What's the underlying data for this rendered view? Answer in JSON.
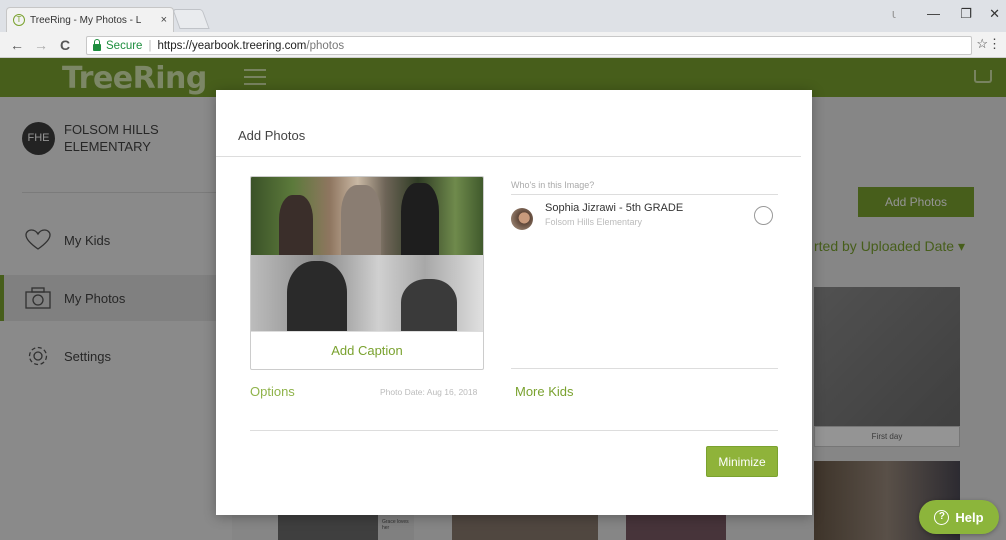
{
  "browser": {
    "tab_title": "TreeRing - My Photos - L",
    "tab_close": "×",
    "secure_label": "Secure",
    "url_host": "https://yearbook.treering.com",
    "url_path": "/photos",
    "back": "←",
    "forward": "→",
    "reload": "C",
    "star": "☆",
    "menu": "⋮",
    "minimize": "—",
    "restore": "❐",
    "close": "✕",
    "user": "⍳"
  },
  "app": {
    "logo": "TreeRing",
    "school": {
      "initials": "FHE",
      "name": "FOLSOM HILLS ELEMENTARY"
    },
    "nav": [
      {
        "label": "My Kids",
        "icon": "heart-icon"
      },
      {
        "label": "My Photos",
        "icon": "camera-icon",
        "active": true
      },
      {
        "label": "Settings",
        "icon": "gear-icon"
      }
    ],
    "main": {
      "add_photos_label": "Add Photos",
      "sort_label": "rted by Uploaded Date ▾",
      "thumb_caption": "First day",
      "small_caption": "Grace loves her"
    }
  },
  "modal": {
    "title": "Add Photos",
    "caption_link": "Add Caption",
    "options_label": "Options",
    "photo_date": "Photo Date: Aug 16, 2018",
    "who_label": "Who's in this Image?",
    "person": {
      "name": "Sophia Jizrawi - 5th GRADE",
      "school": "Folsom Hills Elementary"
    },
    "more_kids_label": "More Kids",
    "minimize_label": "Minimize"
  },
  "help": {
    "label": "Help",
    "glyph": "?"
  },
  "colors": {
    "brand_green": "#7aa22f",
    "button_green": "#8fb33a"
  }
}
